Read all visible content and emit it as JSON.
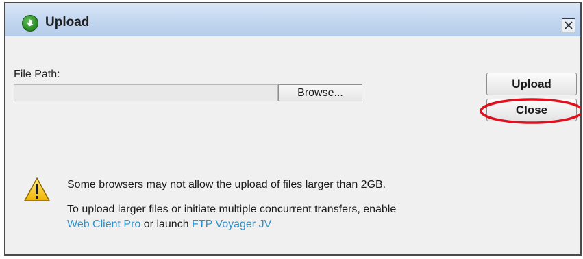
{
  "window": {
    "title": "Upload",
    "title_icon": "app-logo-icon",
    "close_icon": "close-icon"
  },
  "form": {
    "file_path_label": "File Path:",
    "file_path_value": "",
    "browse_label": "Browse..."
  },
  "actions": {
    "upload_label": "Upload",
    "close_label": "Close"
  },
  "notice": {
    "icon": "warning-icon",
    "line1": "Some browsers may not allow the upload of files larger than 2GB.",
    "line2_prefix": "To upload larger files or initiate multiple concurrent transfers, enable",
    "link1": "Web Client Pro",
    "connector": "or launch",
    "link2": "FTP Voyager JV"
  },
  "colors": {
    "link": "#2b91c9",
    "annotation": "#e0101e",
    "titlebar": "#c2d6ef"
  }
}
